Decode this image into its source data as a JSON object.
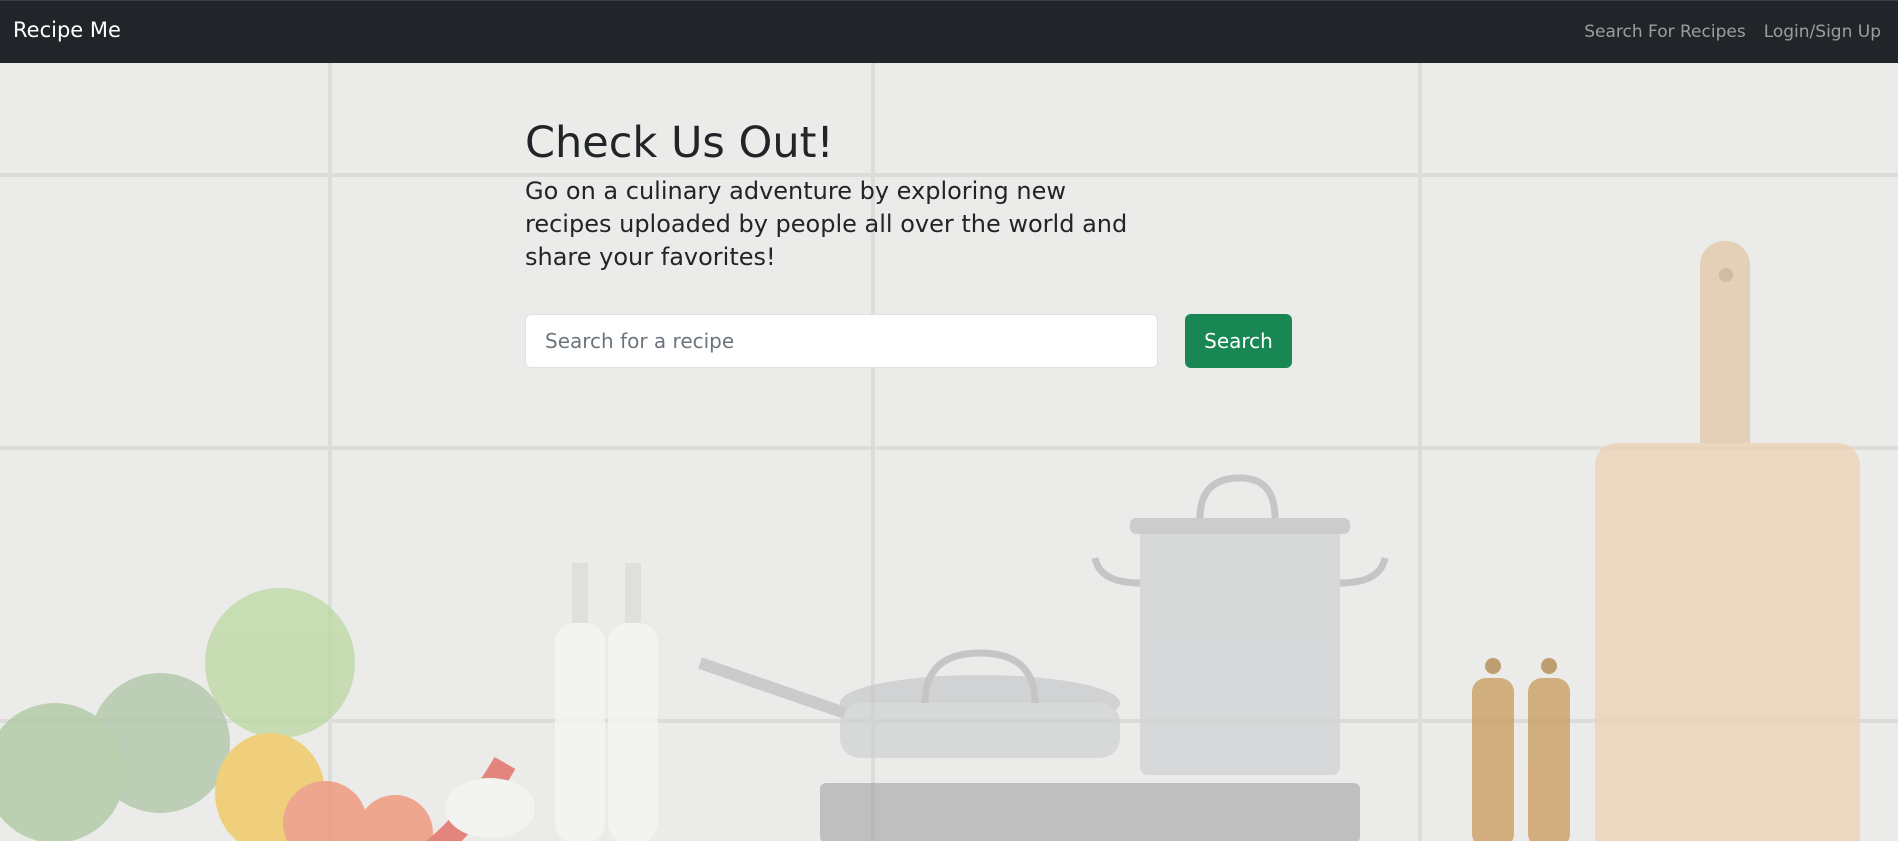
{
  "navbar": {
    "brand": "Recipe Me",
    "links": [
      {
        "label": "Search For Recipes"
      },
      {
        "label": "Login/Sign Up"
      }
    ]
  },
  "hero": {
    "heading": "Check Us Out!",
    "subtitle": "Go on a culinary adventure by exploring new recipes uploaded by people all over the world and share your favorites!",
    "search": {
      "placeholder": "Search for a recipe",
      "value": "",
      "button_label": "Search"
    }
  },
  "colors": {
    "navbar_bg": "#212529",
    "search_button": "#198754",
    "text": "#212529"
  },
  "background": {
    "description_icon": "kitchen-photo"
  }
}
